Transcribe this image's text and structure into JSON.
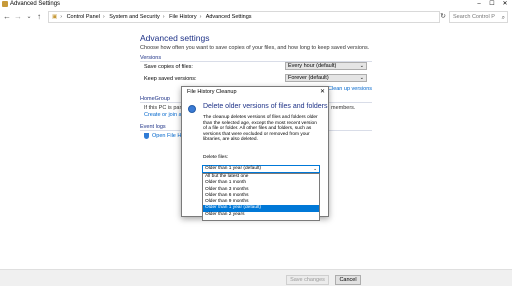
{
  "window": {
    "title": "Advanced Settings",
    "controls": [
      "–",
      "☐",
      "✕"
    ]
  },
  "address": {
    "back": "←",
    "forward": "→",
    "up_history": "⌄",
    "up": "↑",
    "crumbs": [
      "Control Panel",
      "System and Security",
      "File History",
      "Advanced Settings"
    ],
    "refresh": "↻",
    "search_placeholder": "Search Control Panel"
  },
  "page": {
    "heading": "Advanced settings",
    "description": "Choose how often you want to save copies of your files, and how long to keep saved versions.",
    "versions_section": "Versions",
    "save_copies_label": "Save copies of files:",
    "save_copies_value": "Every hour (default)",
    "keep_versions_label": "Keep saved versions:",
    "keep_versions_value": "Forever (default)",
    "cleanup_link": "Clean up versions",
    "homegroup_section": "HomeGroup",
    "homegroup_text": "If this PC is part of",
    "homegroup_text_right": "members.",
    "homegroup_link": "Create or join a ho",
    "eventlogs_section": "Event logs",
    "eventlogs_link": "Open File Hist"
  },
  "footer": {
    "save_label": "Save changes",
    "cancel_label": "Cancel"
  },
  "dialog": {
    "title": "File History Cleanup",
    "heading": "Delete older versions of files and folders",
    "para_lines": [
      "The cleanup deletes versions of files and folders older",
      "than the selected age, except the most recent version",
      "of a file or folder. All other files and folders, such as",
      "versions that were excluded or removed from your",
      "libraries, are also deleted."
    ],
    "delete_label": "Delete files:",
    "selected": "Older than 1 year (default)",
    "options": [
      "All but the latest one",
      "Older than 1 month",
      "Older than 3 months",
      "Older than 6 months",
      "Older than 9 months",
      "Older than 1 year (default)",
      "Older than 2 years"
    ],
    "highlight_index": 5
  }
}
